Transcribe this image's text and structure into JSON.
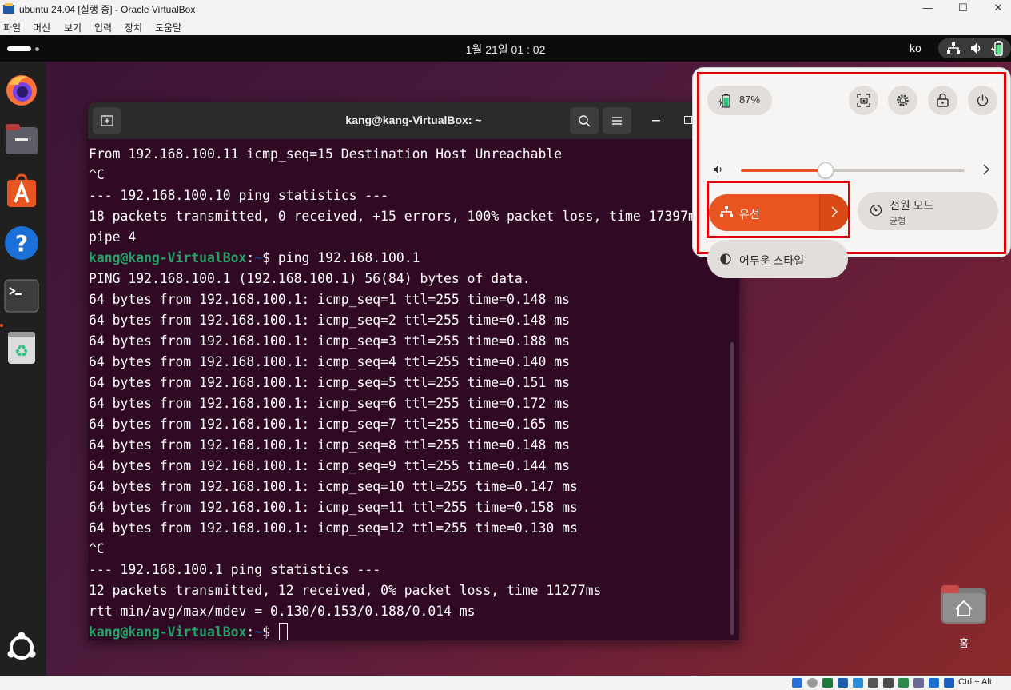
{
  "vbox": {
    "title": "ubuntu 24.04 [실행 중] - Oracle VirtualBox",
    "window_controls": {
      "minimize": "—",
      "maximize": "☐",
      "close": "✕"
    },
    "menu": [
      "파일",
      "머신",
      "보기",
      "입력",
      "장치",
      "도움말"
    ],
    "host_key": "Ctrl + Alt"
  },
  "topbar": {
    "clock": "1월 21일 01 : 02",
    "input_language": "ko"
  },
  "terminal": {
    "title": "kang@kang-VirtualBox: ~",
    "prompt_user": "kang@kang-VirtualBox",
    "prompt_colon": ":",
    "prompt_path": "~",
    "prompt_symbol": "$ ",
    "lines": [
      {
        "text": "From 192.168.100.11 icmp_seq=15 Destination Host Unreachable"
      },
      {
        "text": "^C"
      },
      {
        "text": "--- 192.168.100.10 ping statistics ---"
      },
      {
        "text": "18 packets transmitted, 0 received, +15 errors, 100% packet loss, time 17397ms"
      },
      {
        "text": "pipe 4"
      },
      {
        "prompt": true,
        "text": "ping 192.168.100.1"
      },
      {
        "text": "PING 192.168.100.1 (192.168.100.1) 56(84) bytes of data."
      },
      {
        "text": "64 bytes from 192.168.100.1: icmp_seq=1 ttl=255 time=0.148 ms"
      },
      {
        "text": "64 bytes from 192.168.100.1: icmp_seq=2 ttl=255 time=0.148 ms"
      },
      {
        "text": "64 bytes from 192.168.100.1: icmp_seq=3 ttl=255 time=0.188 ms"
      },
      {
        "text": "64 bytes from 192.168.100.1: icmp_seq=4 ttl=255 time=0.140 ms"
      },
      {
        "text": "64 bytes from 192.168.100.1: icmp_seq=5 ttl=255 time=0.151 ms"
      },
      {
        "text": "64 bytes from 192.168.100.1: icmp_seq=6 ttl=255 time=0.172 ms"
      },
      {
        "text": "64 bytes from 192.168.100.1: icmp_seq=7 ttl=255 time=0.165 ms"
      },
      {
        "text": "64 bytes from 192.168.100.1: icmp_seq=8 ttl=255 time=0.148 ms"
      },
      {
        "text": "64 bytes from 192.168.100.1: icmp_seq=9 ttl=255 time=0.144 ms"
      },
      {
        "text": "64 bytes from 192.168.100.1: icmp_seq=10 ttl=255 time=0.147 ms"
      },
      {
        "text": "64 bytes from 192.168.100.1: icmp_seq=11 ttl=255 time=0.158 ms"
      },
      {
        "text": "64 bytes from 192.168.100.1: icmp_seq=12 ttl=255 time=0.130 ms"
      },
      {
        "text": "^C"
      },
      {
        "text": "--- 192.168.100.1 ping statistics ---"
      },
      {
        "text": "12 packets transmitted, 12 received, 0% packet loss, time 11277ms"
      },
      {
        "text": "rtt min/avg/max/mdev = 0.130/0.153/0.188/0.014 ms"
      },
      {
        "prompt": true,
        "text": "",
        "cursor": true
      }
    ]
  },
  "quick_settings": {
    "battery": "87%",
    "volume_level": 0.38,
    "wired_label": "유선",
    "power_mode_label": "전원 모드",
    "power_mode_value": "균형",
    "dark_style_label": "어두운 스타일"
  },
  "desktop": {
    "home_label": "홈"
  },
  "colors": {
    "accent": "#e95420",
    "terminal_bg": "#300a24",
    "prompt_green": "#26a269",
    "prompt_blue": "#12488b",
    "highlight_red": "#e0000c"
  }
}
